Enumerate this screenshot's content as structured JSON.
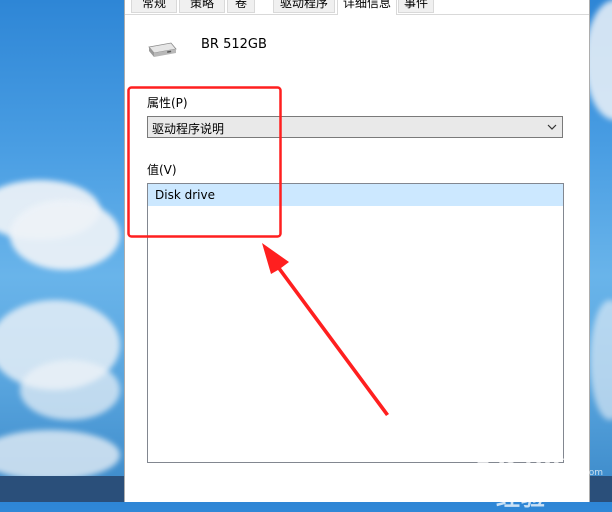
{
  "tabs": [
    {
      "label": "常规"
    },
    {
      "label": "策略"
    },
    {
      "label": "卷"
    },
    {
      "label": "驱动程序"
    },
    {
      "label": "详细信息"
    },
    {
      "label": "事件"
    }
  ],
  "active_tab": "详细信息",
  "device": {
    "name": "BR 512GB",
    "icon": "disk-drive-icon"
  },
  "property": {
    "label": "属性(P)",
    "selected": "驱动程序说明"
  },
  "value": {
    "label": "值(V)",
    "items": [
      "Disk drive"
    ]
  },
  "annotation": {
    "box_color": "#ff1f1f",
    "arrow_color": "#ff1f1f"
  },
  "watermark": {
    "text": "Baidu经验",
    "sub": "jingyan.baidu.com"
  }
}
